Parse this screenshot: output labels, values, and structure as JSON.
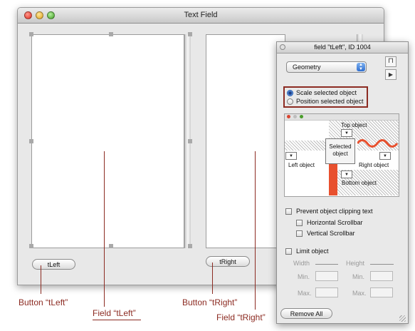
{
  "window": {
    "title": "Text Field",
    "buttons": {
      "left_label": "tLeft",
      "right_label": "tRight"
    }
  },
  "inspector": {
    "title": "field \"tLeft\", ID 1004",
    "pane_select": "Geometry",
    "radios": [
      {
        "label": "Scale selected object",
        "selected": true
      },
      {
        "label": "Position selected object",
        "selected": false
      }
    ],
    "diagram": {
      "top": "Top object",
      "left": "Left object",
      "right": "Right object",
      "bottom": "Bottom object",
      "selected_line1": "Selected",
      "selected_line2": "object",
      "accent_color": "#e8502e"
    },
    "checkboxes": {
      "prevent_clipping": "Prevent object clipping text",
      "hscroll": "Horizontal Scrollbar",
      "vscroll": "Vertical Scrollbar",
      "limit_object": "Limit object"
    },
    "limits": {
      "width": "Width",
      "height": "Height",
      "min": "Min.",
      "max": "Max."
    },
    "remove_all": "Remove All"
  },
  "callouts": {
    "button_tleft": "Button “tLeft”",
    "field_tleft": "Field “tLeft”",
    "button_tright": "Button “tRight”",
    "field_tright": "Field “tRight”",
    "color": "#8c2b22"
  }
}
